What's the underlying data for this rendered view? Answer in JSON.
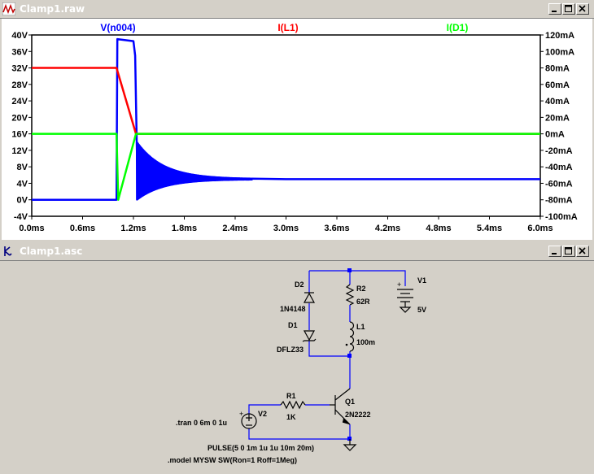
{
  "plot_window": {
    "title": "Clamp1.raw",
    "buttons": {
      "minimize": "_",
      "maximize": "□",
      "close": "X"
    }
  },
  "schematic_window": {
    "title": "Clamp1.asc",
    "buttons": {
      "minimize": "_",
      "maximize": "□",
      "close": "X"
    }
  },
  "chart_data": {
    "type": "line",
    "legend": [
      {
        "name": "V(n004)",
        "color": "#0000ff"
      },
      {
        "name": "I(L1)",
        "color": "#ff0000"
      },
      {
        "name": "I(D1)",
        "color": "#00ff00"
      }
    ],
    "x_ticks": [
      "0.0ms",
      "0.6ms",
      "1.2ms",
      "1.8ms",
      "2.4ms",
      "3.0ms",
      "3.6ms",
      "4.2ms",
      "4.8ms",
      "5.4ms",
      "6.0ms"
    ],
    "y_left_ticks": [
      "40V",
      "36V",
      "32V",
      "28V",
      "24V",
      "20V",
      "16V",
      "12V",
      "8V",
      "4V",
      "0V",
      "-4V"
    ],
    "y_right_ticks": [
      "120mA",
      "100mA",
      "80mA",
      "60mA",
      "40mA",
      "20mA",
      "0mA",
      "-20mA",
      "-40mA",
      "-60mA",
      "-80mA",
      "-100mA"
    ],
    "xlim": [
      0,
      6
    ],
    "ylim_left": [
      -4,
      40
    ],
    "ylim_right": [
      -100,
      120
    ],
    "x_unit": "ms",
    "series": [
      {
        "name": "V(n004)",
        "axis": "left",
        "color": "#0000ff",
        "points": [
          [
            0,
            0
          ],
          [
            1.0,
            0
          ],
          [
            1.01,
            39
          ],
          [
            1.2,
            38.5
          ],
          [
            1.22,
            35
          ],
          [
            1.24,
            12
          ],
          [
            1.3,
            10
          ],
          [
            1.5,
            7
          ],
          [
            2.0,
            5.5
          ],
          [
            3.0,
            5
          ],
          [
            6.0,
            5
          ]
        ],
        "ringing": {
          "start": 1.24,
          "end": 2.6,
          "center": 5,
          "amplitude_start": 7
        }
      },
      {
        "name": "I(L1)",
        "axis": "right",
        "color": "#ff0000",
        "points": [
          [
            0,
            80
          ],
          [
            1.0,
            80
          ],
          [
            1.23,
            0
          ],
          [
            6.0,
            0
          ]
        ]
      },
      {
        "name": "I(D1)",
        "axis": "right",
        "color": "#00ff00",
        "points": [
          [
            0,
            0
          ],
          [
            1.0,
            0
          ],
          [
            1.02,
            -80
          ],
          [
            1.23,
            0
          ],
          [
            6.0,
            0
          ]
        ]
      }
    ]
  },
  "schematic": {
    "components": {
      "D2": {
        "ref": "D2",
        "value": "1N4148"
      },
      "D1": {
        "ref": "D1",
        "value": "DFLZ33"
      },
      "R2": {
        "ref": "R2",
        "value": "62R"
      },
      "L1": {
        "ref": "L1",
        "value": "100m"
      },
      "V1": {
        "ref": "V1",
        "value": "5V"
      },
      "R1": {
        "ref": "R1",
        "value": "1K"
      },
      "Q1": {
        "ref": "Q1",
        "value": "2N2222"
      },
      "V2": {
        "ref": "V2",
        "value": ""
      }
    },
    "directives": {
      "tran": ".tran 0 6m 0 1u",
      "pulse": "PULSE(5 0 1m 1u 1u 10m 20m)",
      "model": ".model MYSW SW(Ron=1 Roff=1Meg)"
    },
    "pin_markers": [
      "+",
      "+",
      "+"
    ]
  }
}
